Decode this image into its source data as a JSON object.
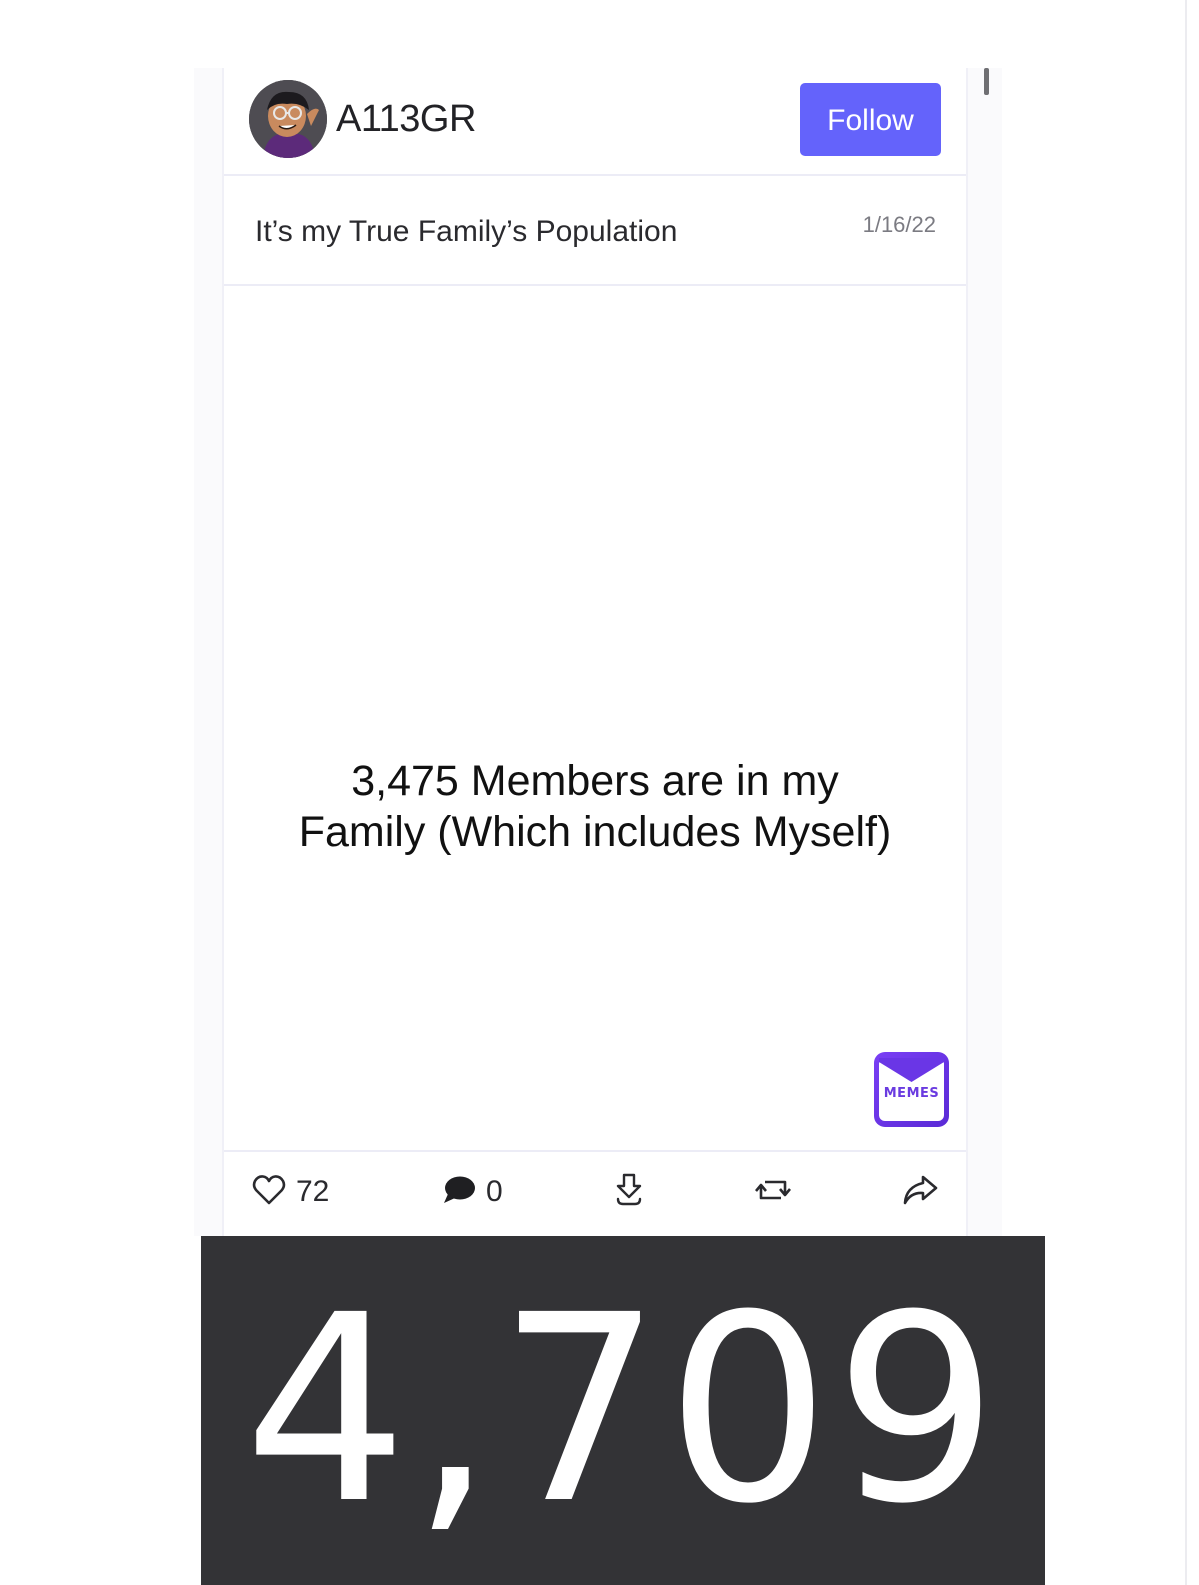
{
  "post": {
    "username": "A113GR",
    "follow_label": "Follow",
    "title": "It’s my True Family’s Population",
    "date": "1/16/22",
    "meme_text": "3,475 Members are in my Family (Which includes Myself)",
    "watermark_label": "MEMES"
  },
  "actions": {
    "likes": "72",
    "comments": "0"
  },
  "banner": {
    "number": "4,709"
  },
  "colors": {
    "accent": "#6463fb",
    "banner_bg": "#333336",
    "logo": "#7a3ff5"
  },
  "icons": [
    "heart-icon",
    "comment-icon",
    "download-icon",
    "repost-icon",
    "share-icon"
  ]
}
